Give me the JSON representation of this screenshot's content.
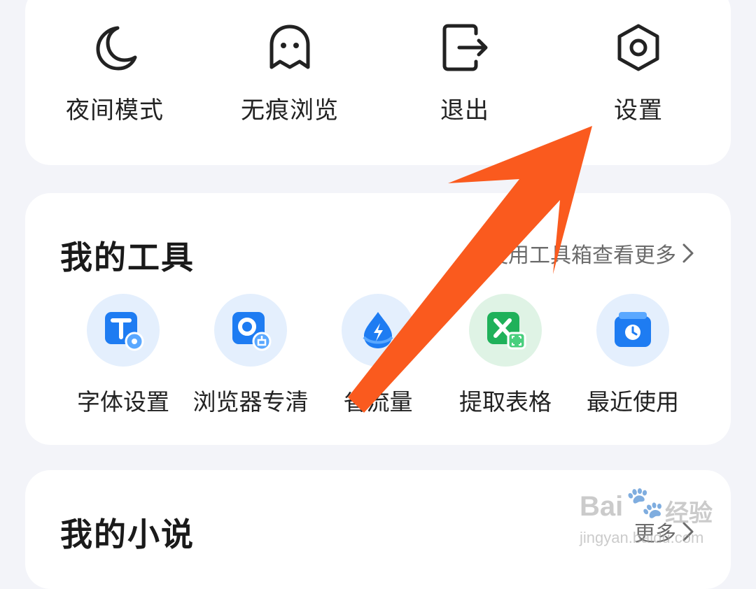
{
  "quick_actions": [
    {
      "label": "夜间模式",
      "icon": "moon-icon"
    },
    {
      "label": "无痕浏览",
      "icon": "ghost-icon"
    },
    {
      "label": "退出",
      "icon": "exit-icon"
    },
    {
      "label": "设置",
      "icon": "settings-hexagon-icon"
    }
  ],
  "tools": {
    "title": "我的工具",
    "more_label": "去使用工具箱查看更多",
    "items": [
      {
        "label": "字体设置",
        "icon": "font-settings-icon",
        "color": "#1e7cf2"
      },
      {
        "label": "浏览器专清",
        "icon": "browser-clean-icon",
        "color": "#1e7cf2"
      },
      {
        "label": "省流量",
        "icon": "data-saver-icon",
        "color": "#1e7cf2"
      },
      {
        "label": "提取表格",
        "icon": "excel-extract-icon",
        "color": "#1fb15a"
      },
      {
        "label": "最近使用",
        "icon": "recent-clock-icon",
        "color": "#1e7cf2"
      }
    ]
  },
  "novels": {
    "title": "我的小说",
    "more_label": "更多"
  },
  "annotation": {
    "arrow_color": "#fa5a1e"
  },
  "watermark": {
    "brand": "Bai",
    "cn": "经验",
    "url": "jingyan.baidu.com"
  }
}
